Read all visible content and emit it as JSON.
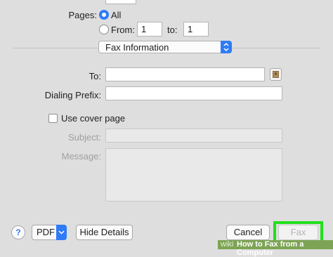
{
  "pages": {
    "label": "Pages:",
    "all_label": "All",
    "from_label": "From:",
    "from_value": "1",
    "to_label": "to:",
    "to_value": "1",
    "selected": "All"
  },
  "section_select": {
    "value": "Fax Information"
  },
  "fax_form": {
    "to_label": "To:",
    "to_value": "",
    "dialing_prefix_label": "Dialing Prefix:",
    "dialing_prefix_value": "",
    "use_cover_page_label": "Use cover page",
    "use_cover_page_checked": false,
    "subject_label": "Subject:",
    "message_label": "Message:"
  },
  "bottom_bar": {
    "help_label": "?",
    "pdf_label": "PDF",
    "hide_details_label": "Hide Details",
    "cancel_label": "Cancel",
    "fax_label": "Fax"
  },
  "watermark": {
    "prefix": "wiki",
    "text": "How to Fax from a Computer"
  },
  "colors": {
    "accent_blue": "#2f7bf6",
    "highlight_green": "#22e01c",
    "background": "#dedede"
  }
}
